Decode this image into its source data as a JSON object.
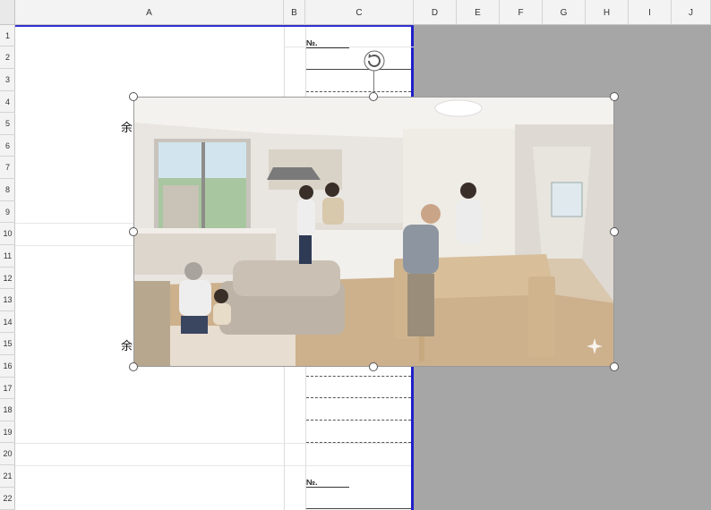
{
  "sheet": {
    "columns": [
      "A",
      "B",
      "C",
      "D",
      "E",
      "F",
      "G",
      "H",
      "I",
      "J"
    ],
    "rows": [
      "1",
      "2",
      "3",
      "4",
      "5",
      "6",
      "7",
      "8",
      "9",
      "10",
      "11",
      "12",
      "13",
      "14",
      "15",
      "16",
      "17",
      "18",
      "19",
      "20",
      "21",
      "22"
    ]
  },
  "cells": {
    "no_label_top": "№.",
    "no_label_bottom": "№.",
    "side_char_1": "余",
    "side_char_2": "余"
  },
  "image": {
    "description_icon": "sparkle-icon",
    "selected": true
  },
  "colors": {
    "print_area_border": "#1f1fc8",
    "outside_print_area": "#a6a6a6"
  }
}
